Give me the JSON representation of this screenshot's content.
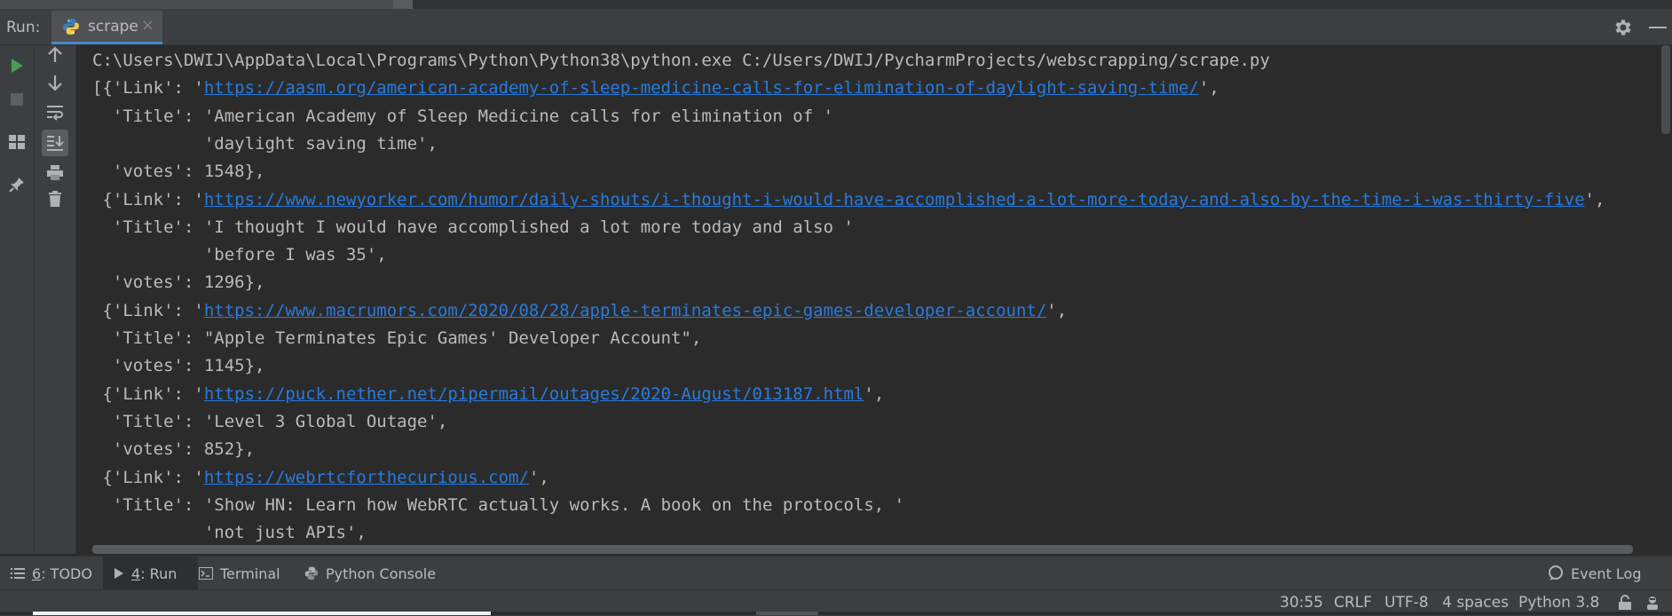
{
  "run_header": {
    "label": "Run:",
    "tab_name": "scrape",
    "tab_close": "×"
  },
  "console": {
    "lines": [
      {
        "segments": [
          {
            "text": "C:\\Users\\DWIJ\\AppData\\Local\\Programs\\Python\\Python38\\python.exe C:/Users/DWIJ/PycharmProjects/webscrapping/scrape.py"
          }
        ]
      },
      {
        "segments": [
          {
            "text": "[{'Link': '"
          },
          {
            "text": "https://aasm.org/american-academy-of-sleep-medicine-calls-for-elimination-of-daylight-saving-time/",
            "link": true
          },
          {
            "text": "',"
          }
        ]
      },
      {
        "segments": [
          {
            "text": "  'Title': 'American Academy of Sleep Medicine calls for elimination of '"
          }
        ]
      },
      {
        "segments": [
          {
            "text": "           'daylight saving time',"
          }
        ]
      },
      {
        "segments": [
          {
            "text": "  'votes': 1548},"
          }
        ]
      },
      {
        "segments": [
          {
            "text": " {'Link': '"
          },
          {
            "text": "https://www.newyorker.com/humor/daily-shouts/i-thought-i-would-have-accomplished-a-lot-more-today-and-also-by-the-time-i-was-thirty-five",
            "link": true
          },
          {
            "text": "',"
          }
        ]
      },
      {
        "segments": [
          {
            "text": "  'Title': 'I thought I would have accomplished a lot more today and also '"
          }
        ]
      },
      {
        "segments": [
          {
            "text": "           'before I was 35',"
          }
        ]
      },
      {
        "segments": [
          {
            "text": "  'votes': 1296},"
          }
        ]
      },
      {
        "segments": [
          {
            "text": " {'Link': '"
          },
          {
            "text": "https://www.macrumors.com/2020/08/28/apple-terminates-epic-games-developer-account/",
            "link": true
          },
          {
            "text": "',"
          }
        ]
      },
      {
        "segments": [
          {
            "text": "  'Title': \"Apple Terminates Epic Games' Developer Account\","
          }
        ]
      },
      {
        "segments": [
          {
            "text": "  'votes': 1145},"
          }
        ]
      },
      {
        "segments": [
          {
            "text": " {'Link': '"
          },
          {
            "text": "https://puck.nether.net/pipermail/outages/2020-August/013187.html",
            "link": true
          },
          {
            "text": "',"
          }
        ]
      },
      {
        "segments": [
          {
            "text": "  'Title': 'Level 3 Global Outage',"
          }
        ]
      },
      {
        "segments": [
          {
            "text": "  'votes': 852},"
          }
        ]
      },
      {
        "segments": [
          {
            "text": " {'Link': '"
          },
          {
            "text": "https://webrtcforthecurious.com/",
            "link": true
          },
          {
            "text": "',"
          }
        ]
      },
      {
        "segments": [
          {
            "text": "  'Title': 'Show HN: Learn how WebRTC actually works. A book on the protocols, '"
          }
        ]
      },
      {
        "segments": [
          {
            "text": "           'not just APIs',"
          }
        ]
      }
    ]
  },
  "bottom_tools": {
    "todo_num": "6",
    "todo_label": ": TODO",
    "run_num": "4",
    "run_label": ": Run",
    "terminal": "Terminal",
    "python_console": "Python Console",
    "event_log": "Event Log"
  },
  "status": {
    "position": "30:55",
    "line_sep": "CRLF",
    "encoding": "UTF-8",
    "indent": "4 spaces",
    "interpreter": "Python 3.8"
  },
  "colors": {
    "background": "#2b2b2b",
    "panel": "#3c3f41",
    "text": "#bbbbbb",
    "link": "#287bde",
    "run_green": "#499c54",
    "accent": "#4a88c7"
  }
}
